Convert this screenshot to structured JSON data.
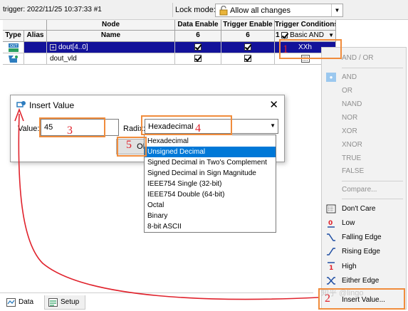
{
  "toolbar": {
    "trigger_text": "trigger: 2022/11/25 10:37:33  #1",
    "lock_mode_label": "Lock mode:",
    "lock_mode_value": "Allow all changes"
  },
  "table": {
    "headers_top": {
      "node": "Node",
      "data_enable": "Data Enable",
      "trigger_enable": "Trigger Enable",
      "trigger_conditions": "Trigger Conditions"
    },
    "headers_sub": {
      "type": "Type",
      "alias": "Alias",
      "name": "Name",
      "data_enable_count": "6",
      "trigger_enable_count": "6",
      "condition_prefix": "1",
      "condition_value": "Basic AND"
    },
    "rows": [
      {
        "name": "dout[4..0]",
        "condition": "XXh",
        "selected": true
      },
      {
        "name": "dout_vld",
        "condition": "",
        "selected": false
      }
    ]
  },
  "dialog": {
    "title": "Insert Value",
    "value_label": "Value:",
    "value": "45",
    "radix_label": "Radix:",
    "radix_value": "Hexadecimal",
    "ok_label": "OK"
  },
  "radix_options": [
    "Hexadecimal",
    "Unsigned Decimal",
    "Signed Decimal in Two's Complement",
    "Signed Decimal in Sign Magnitude",
    "IEEE754 Single (32-bit)",
    "IEEE754 Double (64-bit)",
    "Octal",
    "Binary",
    "8-bit ASCII"
  ],
  "radix_highlighted": "Unsigned Decimal",
  "context_menu": {
    "items": [
      {
        "label": "AND / OR",
        "disabled": true,
        "icon": ""
      },
      {
        "label": "AND",
        "disabled": true,
        "icon": "checkmark"
      },
      {
        "label": "OR",
        "disabled": true,
        "icon": ""
      },
      {
        "label": "NAND",
        "disabled": true,
        "icon": ""
      },
      {
        "label": "NOR",
        "disabled": true,
        "icon": ""
      },
      {
        "label": "XOR",
        "disabled": true,
        "icon": ""
      },
      {
        "label": "XNOR",
        "disabled": true,
        "icon": ""
      },
      {
        "label": "TRUE",
        "disabled": true,
        "icon": ""
      },
      {
        "label": "FALSE",
        "disabled": true,
        "icon": ""
      },
      {
        "label": "Compare...",
        "disabled": true,
        "icon": ""
      },
      {
        "label": "Don't Care",
        "disabled": false,
        "icon": "dont-care-icon"
      },
      {
        "label": "Low",
        "disabled": false,
        "icon": "low-icon"
      },
      {
        "label": "Falling Edge",
        "disabled": false,
        "icon": "falling-edge-icon"
      },
      {
        "label": "Rising Edge",
        "disabled": false,
        "icon": "rising-edge-icon"
      },
      {
        "label": "High",
        "disabled": false,
        "icon": "high-icon"
      },
      {
        "label": "Either Edge",
        "disabled": false,
        "icon": "either-edge-icon"
      },
      {
        "label": "Insert Value...",
        "disabled": false,
        "icon": ""
      }
    ]
  },
  "tabs": [
    {
      "label": "Data",
      "active": false
    },
    {
      "label": "Setup",
      "active": true
    }
  ],
  "annotations": [
    "1",
    "2",
    "3",
    "4",
    "5"
  ],
  "watermark": "知乎 @lingo",
  "colors": {
    "selected_row": "#13129a",
    "highlight": "#0078d7",
    "annotation_box": "#f08c3c",
    "annotation_text": "#e0222c"
  }
}
